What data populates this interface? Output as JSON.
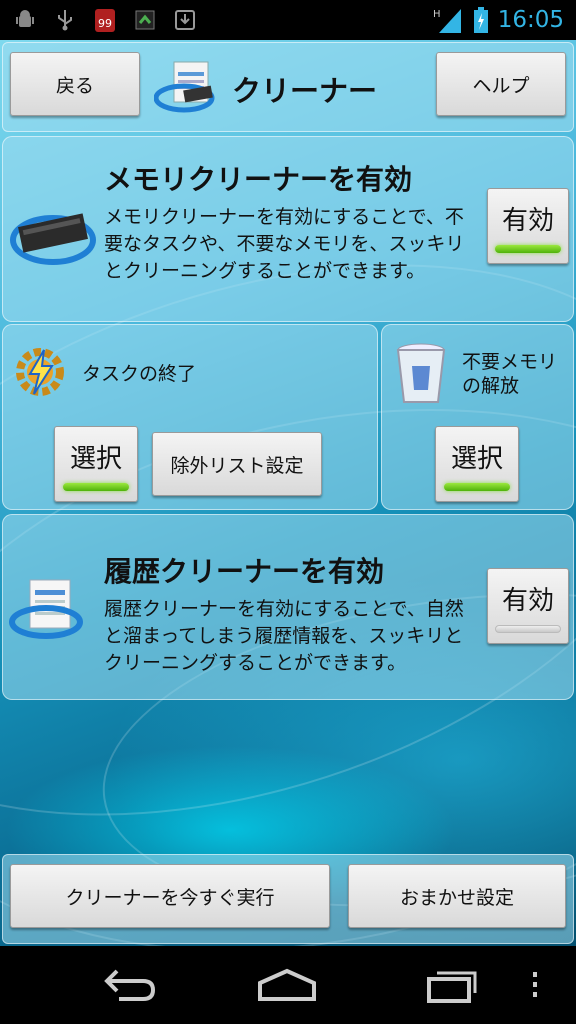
{
  "status_bar": {
    "time": "16:05",
    "left_icons": [
      "android-debug-icon",
      "usb-icon",
      "battery-99-icon",
      "sync-icon",
      "download-icon"
    ],
    "battery_badge": "99",
    "network_label": "H"
  },
  "header": {
    "back_label": "戻る",
    "title": "クリーナー",
    "help_label": "ヘルプ"
  },
  "memory_cleaner": {
    "title": "メモリクリーナーを有効",
    "description": "メモリクリーナーを有効にすることで、不要なタスクや、不要なメモリを、スッキリとクリーニングすることができます。",
    "toggle_label": "有効",
    "enabled": true
  },
  "task_kill": {
    "label": "タスクの終了",
    "select_label": "選択",
    "select_enabled": true,
    "exclude_label": "除外リスト設定"
  },
  "free_memory": {
    "label": "不要メモリの解放",
    "select_label": "選択",
    "select_enabled": true
  },
  "history_cleaner": {
    "title": "履歴クリーナーを有効",
    "description": "履歴クリーナーを有効にすることで、自然と溜まってしまう履歴情報を、スッキリとクリーニングすることができます。",
    "toggle_label": "有効",
    "enabled": false
  },
  "footer": {
    "run_now_label": "クリーナーを今すぐ実行",
    "auto_settings_label": "おまかせ設定"
  },
  "colors": {
    "accent_clock": "#33b5e5",
    "indicator_on": "#6fd11f"
  }
}
